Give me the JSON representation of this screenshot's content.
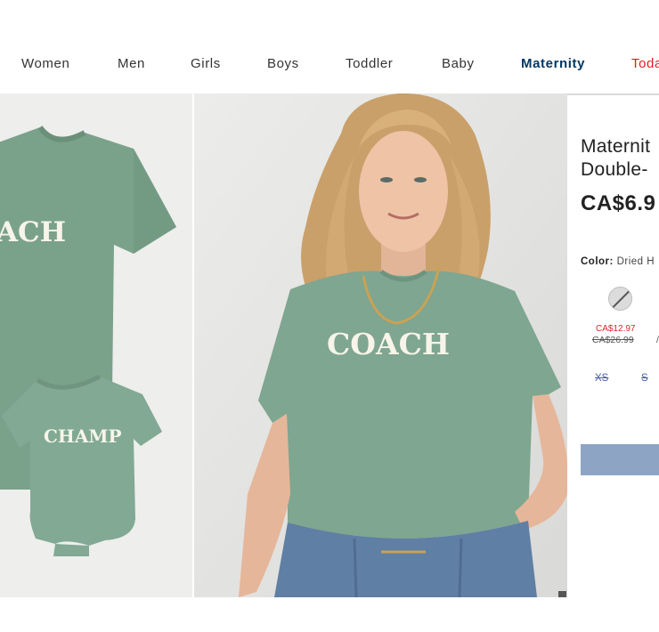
{
  "nav": {
    "items": [
      {
        "label": "Women"
      },
      {
        "label": "Men"
      },
      {
        "label": "Girls"
      },
      {
        "label": "Boys"
      },
      {
        "label": "Toddler"
      },
      {
        "label": "Baby"
      },
      {
        "label": "Maternity"
      },
      {
        "label": "Toda"
      }
    ],
    "active": "Maternity",
    "sale_color": "#e31c23",
    "active_color": "#003764"
  },
  "images": {
    "left_adult_print": "ACH",
    "left_baby_print": "CHAMP",
    "main_print": "COACH",
    "shirt_color": "#7ea690"
  },
  "product": {
    "title_line1": "Maternit",
    "title_line2": "Double-",
    "price": "CA$6.9",
    "color_label": "Color:",
    "color_value": "Dried H",
    "swatch_sale_price": "CA$12.97",
    "swatch_original_price": "CA$26.99",
    "sizes": [
      "XS",
      "S"
    ],
    "button_color": "#8ea4c4"
  }
}
